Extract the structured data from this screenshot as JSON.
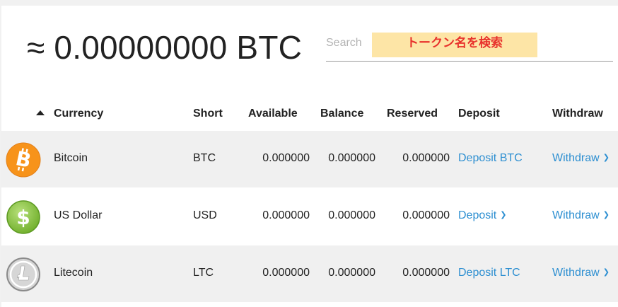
{
  "header": {
    "balance": "≈ 0.00000000 BTC",
    "search_placeholder": "Search",
    "search_hint": "トークン名を検索"
  },
  "table": {
    "columns": [
      "Currency",
      "Short",
      "Available",
      "Balance",
      "Reserved",
      "Deposit",
      "Withdraw"
    ],
    "rows": [
      {
        "icon": "bitcoin-icon",
        "currency": "Bitcoin",
        "short": "BTC",
        "available": "0.000000",
        "balance": "0.000000",
        "reserved": "0.000000",
        "deposit": "Deposit BTC",
        "withdraw": "Withdraw"
      },
      {
        "icon": "dollar-icon",
        "currency": "US Dollar",
        "short": "USD",
        "available": "0.000000",
        "balance": "0.000000",
        "reserved": "0.000000",
        "deposit": "Deposit",
        "withdraw": "Withdraw"
      },
      {
        "icon": "litecoin-icon",
        "currency": "Litecoin",
        "short": "LTC",
        "available": "0.000000",
        "balance": "0.000000",
        "reserved": "0.000000",
        "deposit": "Deposit LTC",
        "withdraw": "Withdraw"
      }
    ]
  },
  "colors": {
    "link": "#2d8fd1",
    "hint_bg": "#fde5a6",
    "hint_text": "#e8322c",
    "bitcoin": "#f7931a",
    "dollar": "#8dc63f",
    "litecoin": "#bebebe"
  }
}
